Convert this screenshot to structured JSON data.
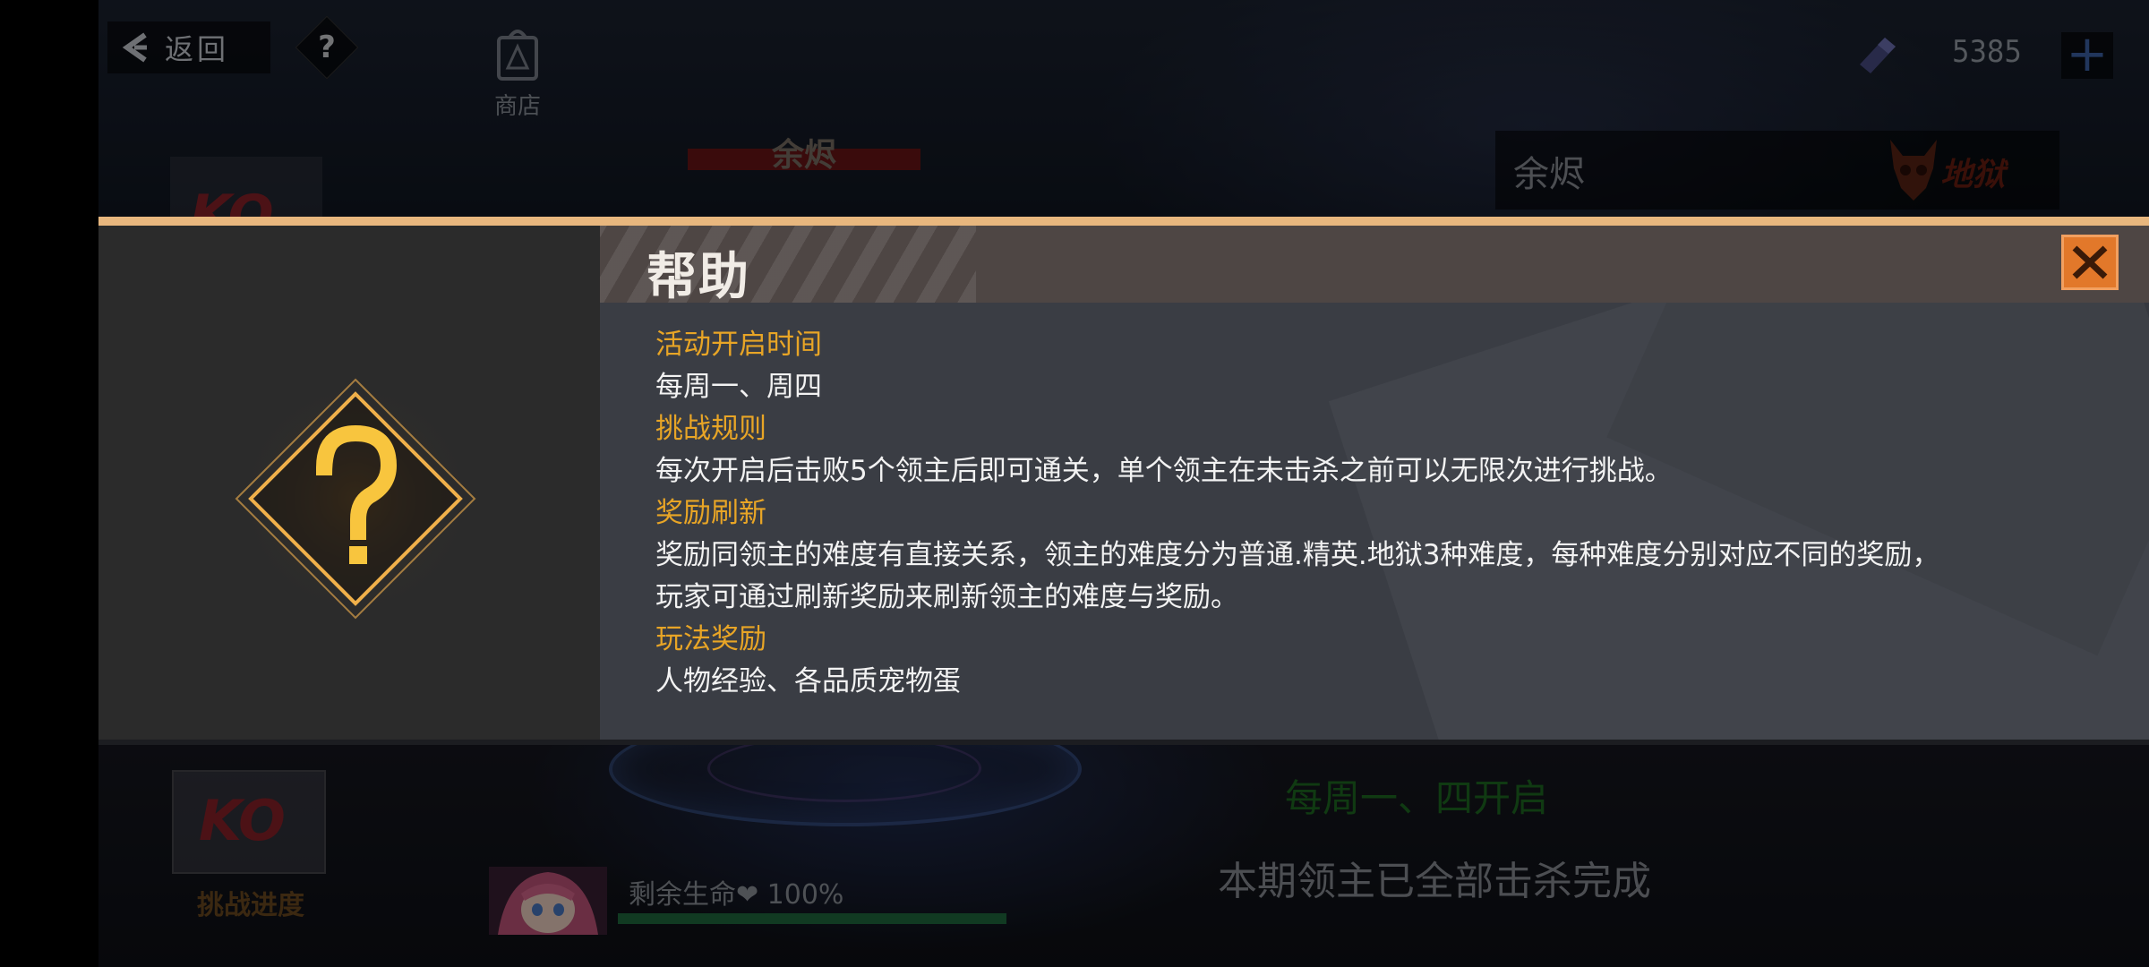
{
  "topbar": {
    "back_label": "返回",
    "help_glyph": "?",
    "shop_label": "商店",
    "currency_value": "5385",
    "plus_glyph": "+"
  },
  "boss": {
    "name": "余烬",
    "name_panel": "余烬",
    "difficulty": "地狱",
    "ko_top": "KO",
    "ko_bottom": "KO"
  },
  "modal": {
    "title": "帮助",
    "sections": [
      {
        "heading": "活动开启时间",
        "lines": [
          "每周一、周四"
        ]
      },
      {
        "heading": "挑战规则",
        "lines": [
          "每次开启后击败5个领主后即可通关，单个领主在未击杀之前可以无限次进行挑战。"
        ]
      },
      {
        "heading": "奖励刷新",
        "lines": [
          "奖励同领主的难度有直接关系，领主的难度分为普通.精英.地狱3种难度，每种难度分别对应不同的奖励，",
          "玩家可通过刷新奖励来刷新领主的难度与奖励。"
        ]
      },
      {
        "heading": "玩法奖励",
        "lines": [
          "人物经验、各品质宠物蛋"
        ]
      }
    ]
  },
  "bottom": {
    "challenge_progress": "挑战进度",
    "open_days": "每周一、四开启",
    "all_killed": "本期领主已全部击杀完成",
    "life_label": "剩余生命❤ 100%",
    "life_percent": 100
  },
  "colors": {
    "accent_orange": "#e2782a",
    "heading_gold": "#e8a526",
    "modal_border": "#e8b77e"
  },
  "icons": [
    "back-chevron-icon",
    "help-icon",
    "shop-bag-icon",
    "currency-crystal-icon",
    "plus-icon",
    "hell-skull-icon",
    "close-icon",
    "question-diamond-icon"
  ]
}
